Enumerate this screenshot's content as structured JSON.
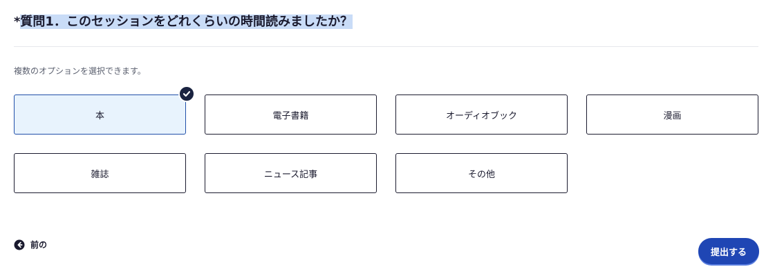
{
  "question": {
    "asterisk": "*",
    "title": "質問1．このセッションをどれくらいの時間読みましたか？"
  },
  "hint": "複数のオプションを選択できます。",
  "options": [
    {
      "label": "本",
      "selected": true
    },
    {
      "label": "電子書籍",
      "selected": false
    },
    {
      "label": "オーディオブック",
      "selected": false
    },
    {
      "label": "漫画",
      "selected": false
    },
    {
      "label": "雑誌",
      "selected": false
    },
    {
      "label": "ニュース記事",
      "selected": false
    },
    {
      "label": "その他",
      "selected": false
    }
  ],
  "nav": {
    "prev_label": "前の",
    "prev_icon": "arrow-left-circle-icon",
    "submit_label": "提出する"
  },
  "colors": {
    "text": "#1a1a2e",
    "selected_bg": "#e8f3fd",
    "selected_border": "#1f4ea8",
    "check_badge": "#1a2340",
    "submit_bg": "#1f46b4",
    "title_highlight": "#c9dcf7"
  }
}
